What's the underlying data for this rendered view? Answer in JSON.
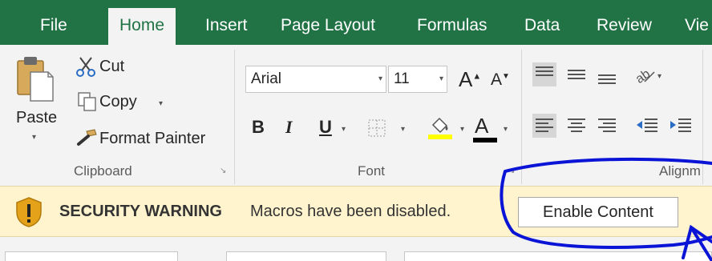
{
  "tabs": [
    {
      "label": "File",
      "active": false
    },
    {
      "label": "Home",
      "active": true
    },
    {
      "label": "Insert",
      "active": false
    },
    {
      "label": "Page Layout",
      "active": false
    },
    {
      "label": "Formulas",
      "active": false
    },
    {
      "label": "Data",
      "active": false
    },
    {
      "label": "Review",
      "active": false
    },
    {
      "label": "Vie",
      "active": false
    }
  ],
  "clipboard": {
    "paste_label": "Paste",
    "cut_label": "Cut",
    "copy_label": "Copy",
    "format_painter_label": "Format Painter",
    "group_label": "Clipboard"
  },
  "font": {
    "font_name": "Arial",
    "font_size": "11",
    "group_label": "Font",
    "bold_label": "B",
    "italic_label": "I",
    "underline_label": "U",
    "font_color_letter": "A",
    "highlight_color": "#ffff00",
    "font_color": "#000000"
  },
  "alignment": {
    "group_label": "Alignm"
  },
  "security_bar": {
    "title": "SECURITY WARNING",
    "message": "Macros have been disabled.",
    "button_label": "Enable Content"
  },
  "colors": {
    "ribbon_green": "#217346",
    "warning_bg": "#fff4ce",
    "annotation_blue": "#0a14d6"
  }
}
